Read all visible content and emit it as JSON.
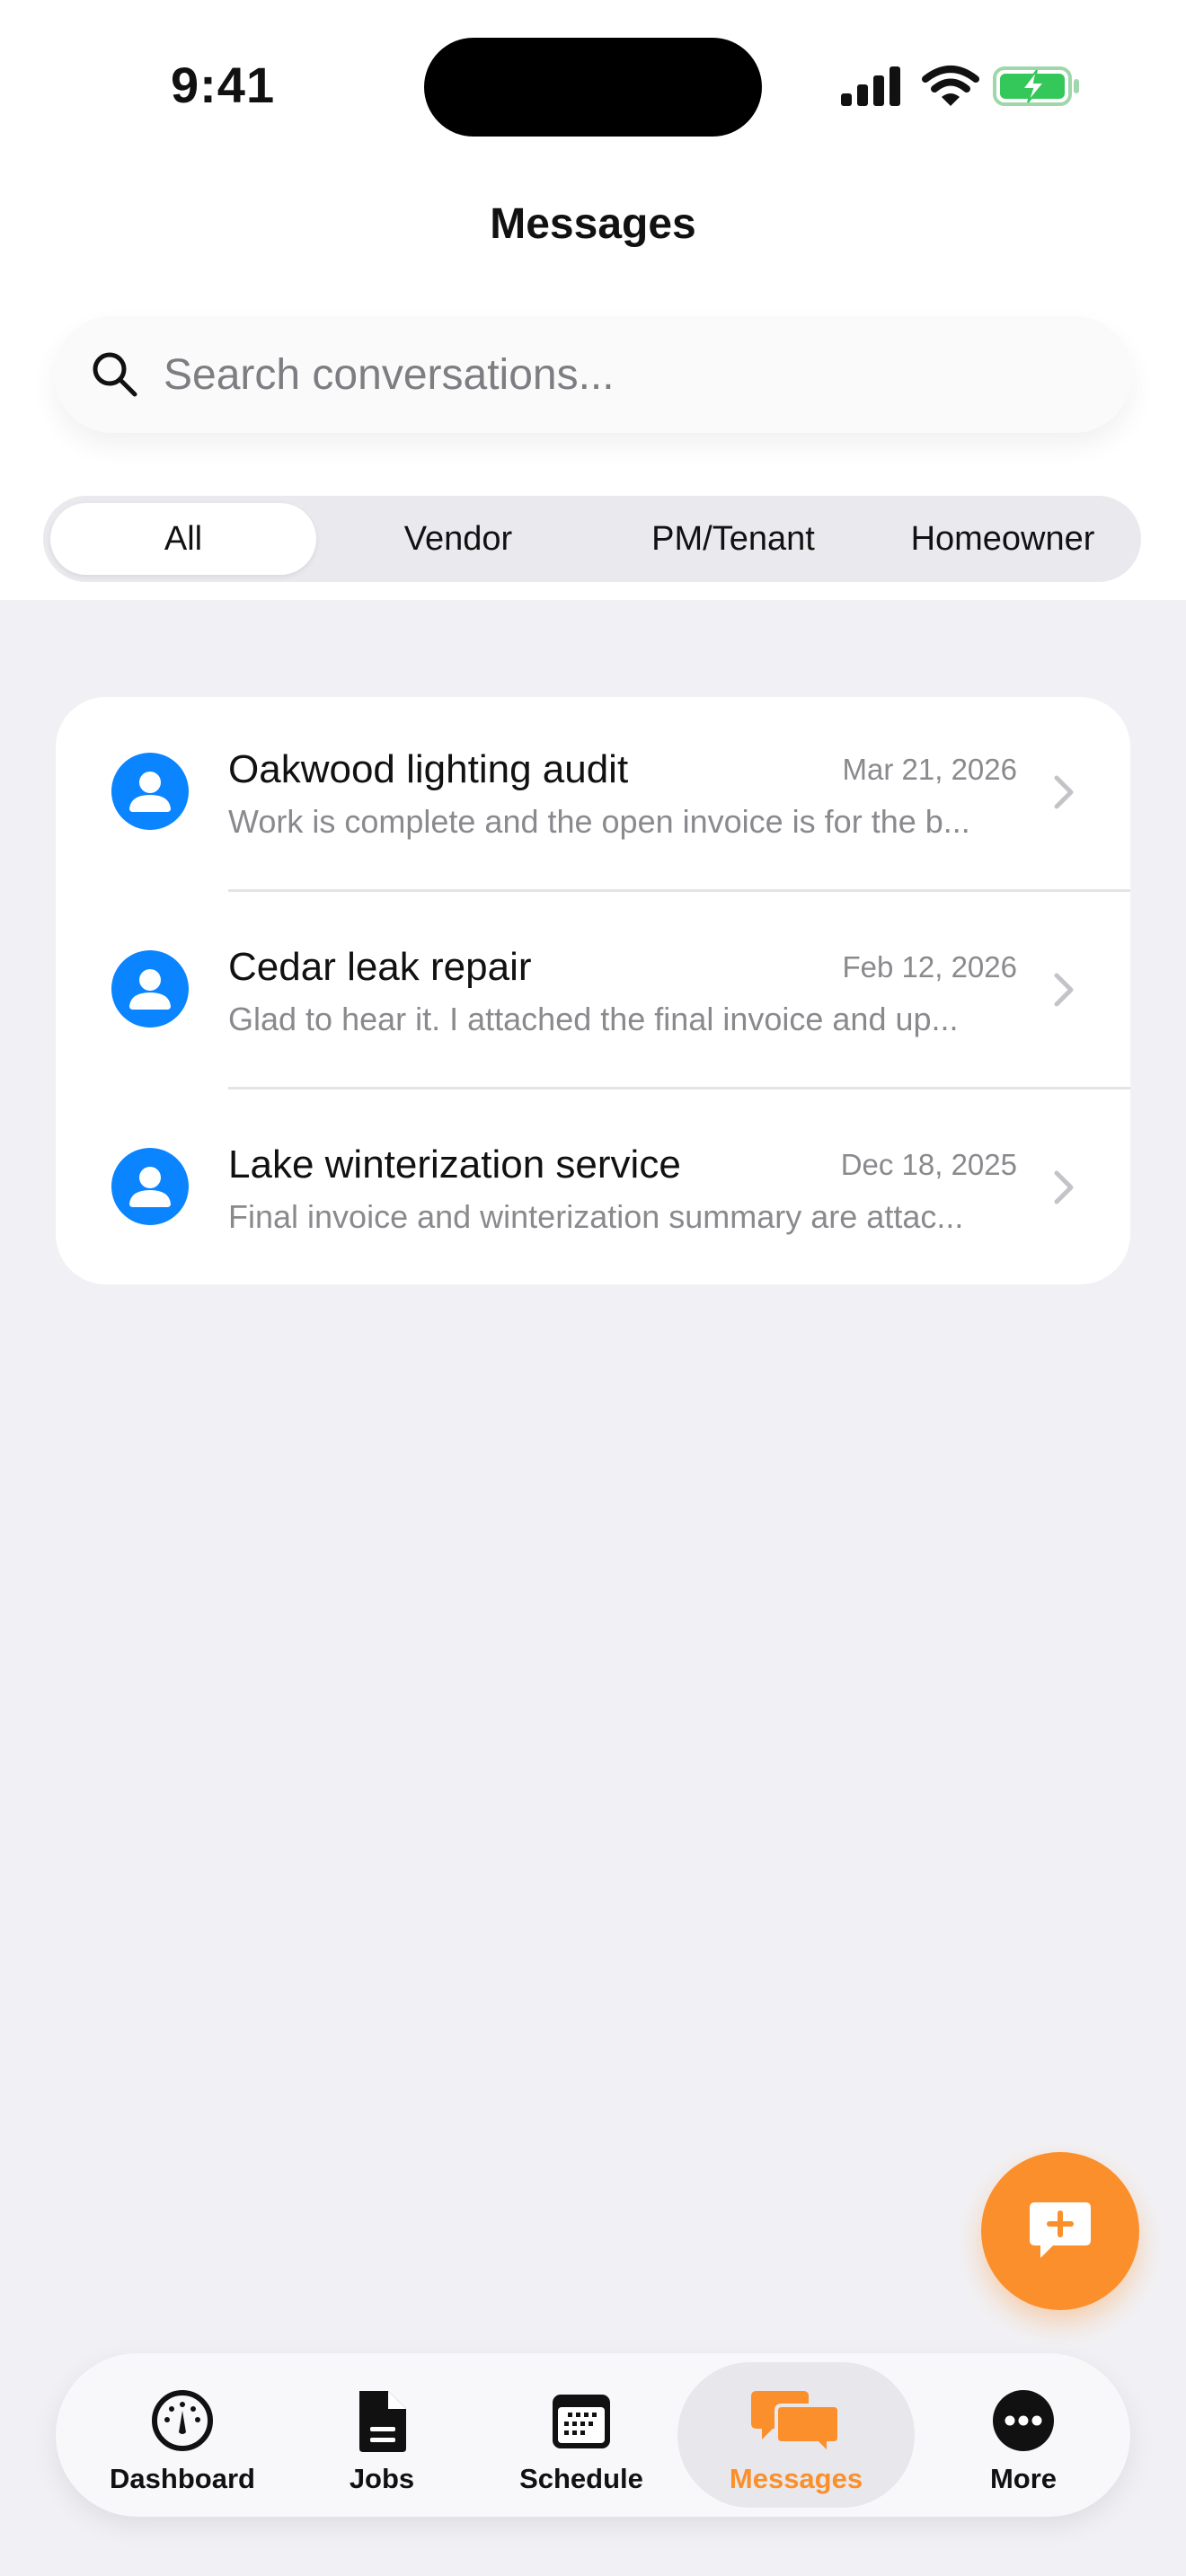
{
  "status_bar": {
    "time": "9:41"
  },
  "header": {
    "title": "Messages"
  },
  "search": {
    "placeholder": "Search conversations...",
    "value": ""
  },
  "filters": {
    "options": [
      "All",
      "Vendor",
      "PM/Tenant",
      "Homeowner"
    ],
    "selected": "All"
  },
  "conversations": [
    {
      "title": "Oakwood lighting audit",
      "date": "Mar 21, 2026",
      "preview": "Work is complete and the open invoice is for the b..."
    },
    {
      "title": "Cedar leak repair",
      "date": "Feb 12, 2026",
      "preview": "Glad to hear it. I attached the final invoice and up..."
    },
    {
      "title": "Lake winterization service",
      "date": "Dec 18, 2025",
      "preview": "Final invoice and winterization summary are attac..."
    }
  ],
  "tab_bar": {
    "items": [
      {
        "label": "Dashboard",
        "icon": "gauge-icon"
      },
      {
        "label": "Jobs",
        "icon": "document-icon"
      },
      {
        "label": "Schedule",
        "icon": "calendar-icon"
      },
      {
        "label": "Messages",
        "icon": "chat-bubbles-icon"
      },
      {
        "label": "More",
        "icon": "more-icon"
      }
    ],
    "active": "Messages"
  },
  "colors": {
    "accent": "#fb8f2b",
    "avatar": "#0a84ff",
    "battery": "#34c759",
    "background": "#f1f1f5"
  }
}
